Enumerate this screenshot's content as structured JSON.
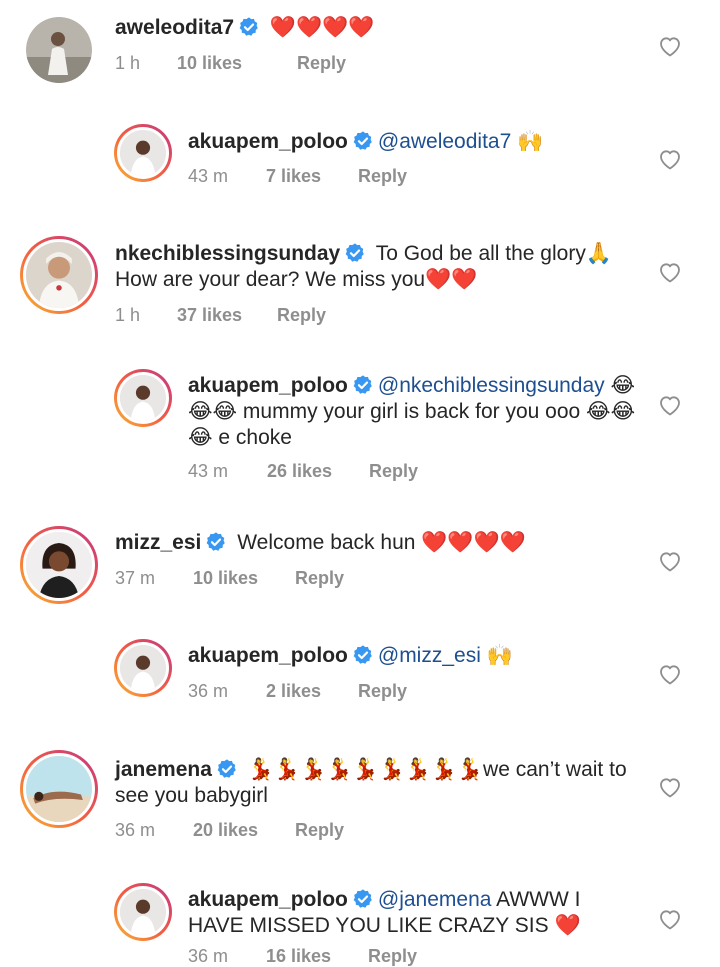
{
  "comments": [
    {
      "username": "aweleodita7",
      "text": " ❤️❤️❤️❤️",
      "time": "1 h",
      "likes": "10 likes",
      "reply": "Reply"
    },
    {
      "username": "akuapem_poloo",
      "mention": "@aweleodita7",
      "text": " 🙌",
      "time": "43 m",
      "likes": "7 likes",
      "reply": "Reply"
    },
    {
      "username": "nkechiblessingsunday",
      "text": " To God be all the glory🙏 How are your dear? We miss you❤️❤️",
      "time": "1 h",
      "likes": "37 likes",
      "reply": "Reply"
    },
    {
      "username": "akuapem_poloo",
      "mention": "@nkechiblessingsunday",
      "text": " 😂😂😂 mummy your girl is back for you ooo 😂😂😂 e choke",
      "time": "43 m",
      "likes": "26 likes",
      "reply": "Reply"
    },
    {
      "username": "mizz_esi",
      "text": " Welcome back hun ❤️❤️❤️❤️",
      "time": "37 m",
      "likes": "10 likes",
      "reply": "Reply"
    },
    {
      "username": "akuapem_poloo",
      "mention": "@mizz_esi",
      "text": " 🙌",
      "time": "36 m",
      "likes": "2 likes",
      "reply": "Reply"
    },
    {
      "username": "janemena",
      "text": " 💃💃💃💃💃💃💃💃💃we can’t wait to see you babygirl",
      "time": "36 m",
      "likes": "20 likes",
      "reply": "Reply"
    },
    {
      "username": "akuapem_poloo",
      "mention": "@janemena",
      "text": " AWWW I HAVE MISSED YOU LIKE CRAZY SIS ❤️",
      "time": "36 m",
      "likes": "16 likes",
      "reply": "Reply"
    }
  ],
  "colors": {
    "verified": "#3897f0",
    "mention": "#1d4f91",
    "meta": "#8e8e8e",
    "ring_start": "#f7b733",
    "ring_end": "#c13584"
  },
  "icons": {
    "verified": "verified-badge-icon",
    "like": "heart-outline-icon"
  }
}
